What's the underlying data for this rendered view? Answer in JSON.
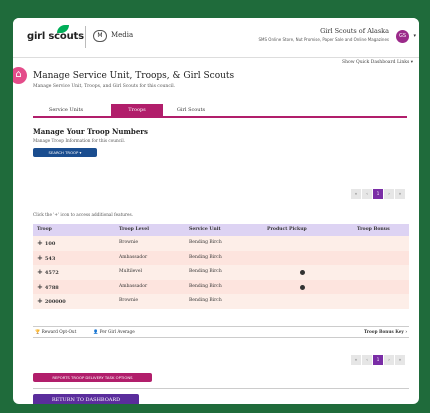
{
  "header": {
    "logo_text": "girl scouts",
    "mode_badge": "M",
    "mode_label": "Media",
    "council_name": "Girl Scouts of Alaska",
    "council_sub": "SMS Online Store, Nut Promise, Paper Sale and Online Magazines",
    "avatar_initials": "GS",
    "caret": "▾"
  },
  "page": {
    "home_icon": "⌂",
    "quick_links": "Show Quick Dashboard Links ▾",
    "title": "Manage Service Unit, Troops, & Girl Scouts",
    "subtitle": "Manage Service Unit, Troops, and Girl Scouts for this council."
  },
  "tabs": [
    {
      "label": "Service Units",
      "active": false
    },
    {
      "label": "Troops",
      "active": true
    },
    {
      "label": "Girl Scouts",
      "active": false
    }
  ],
  "section": {
    "title": "Manage Your Troop Numbers",
    "subtitle": "Manage Troop Information for this council.",
    "search_button": "SEARCH TROOP ▾"
  },
  "pager": [
    "«",
    "‹",
    "1",
    "›",
    "»"
  ],
  "hint": "Click the '+' icon to access additional features.",
  "table": {
    "headers": [
      "Troop",
      "Troop Level",
      "Service Unit",
      "Product Pickup",
      "Troop Bonus"
    ],
    "rows": [
      {
        "troop": "100",
        "level": "Brownie",
        "unit": "Bending Birch",
        "pickup": false
      },
      {
        "troop": "543",
        "level": "Ambassador",
        "unit": "Bending Birch",
        "pickup": false
      },
      {
        "troop": "4572",
        "level": "Multilevel",
        "unit": "Bending Birch",
        "pickup": true
      },
      {
        "troop": "4788",
        "level": "Ambassador",
        "unit": "Bending Birch",
        "pickup": true
      },
      {
        "troop": "200000",
        "level": "Brownie",
        "unit": "Bending Birch",
        "pickup": false
      }
    ]
  },
  "legend": {
    "reward": "Reward Opt-Out",
    "per_girl": "Per Girl Average",
    "key": "Troop Bonus Key ›"
  },
  "actions": {
    "report": "REPORTS TROOP DELIVERY TASK OPTIONS",
    "return": "RETURN TO DASHBOARD"
  }
}
